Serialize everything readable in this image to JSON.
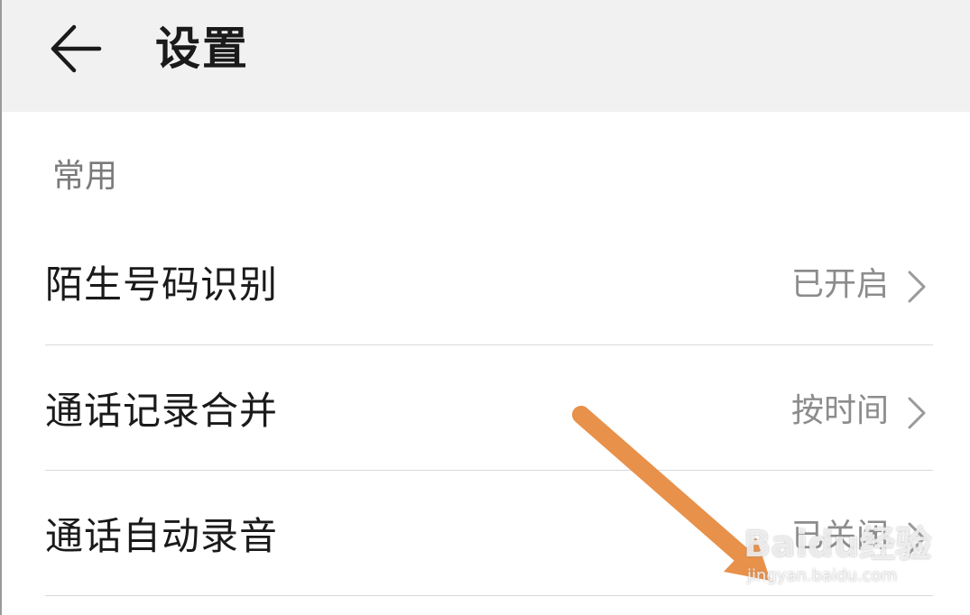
{
  "header": {
    "back_icon": "arrow-left-icon",
    "title": "设置"
  },
  "section": {
    "label": "常用"
  },
  "rows": [
    {
      "label": "陌生号码识别",
      "value": "已开启",
      "icon": "chevron-right-icon"
    },
    {
      "label": "通话记录合并",
      "value": "按时间",
      "icon": "chevron-right-icon"
    },
    {
      "label": "通话自动录音",
      "value": "已关闭",
      "icon": "chevron-right-icon"
    }
  ],
  "annotation": {
    "arrow_color": "#E8914A"
  },
  "watermark": {
    "logo": "Baidu经验",
    "url": "jingyan.baidu.com"
  },
  "colors": {
    "header_bg": "#f1f1f1",
    "text_primary": "#1a1a1a",
    "text_secondary": "#8c8c8c",
    "divider": "#d8d8d8"
  }
}
